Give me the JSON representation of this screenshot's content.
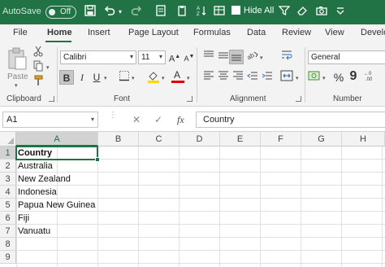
{
  "title_bar": {
    "autosave_label": "AutoSave",
    "autosave_state": "Off",
    "hide_all_label": "Hide All"
  },
  "ribbon_tabs": [
    "File",
    "Home",
    "Insert",
    "Page Layout",
    "Formulas",
    "Data",
    "Review",
    "View",
    "Develo"
  ],
  "active_tab": "Home",
  "clipboard": {
    "paste_label": "Paste",
    "group_label": "Clipboard"
  },
  "font": {
    "name": "Calibri",
    "size": "11",
    "group_label": "Font",
    "bold": "B",
    "italic": "I",
    "underline": "U",
    "color_letter": "A"
  },
  "alignment": {
    "group_label": "Alignment"
  },
  "number": {
    "format": "General",
    "group_label": "Number",
    "percent": "%",
    "comma": "9"
  },
  "formula_bar": {
    "name_box": "A1",
    "cancel_symbol": "✕",
    "enter_symbol": "✓",
    "fx_label": "fx",
    "value": "Country"
  },
  "sheet": {
    "columns": [
      "A",
      "B",
      "C",
      "D",
      "E",
      "F",
      "G",
      "H"
    ],
    "rows": [
      "1",
      "2",
      "3",
      "4",
      "5",
      "6",
      "7",
      "8",
      "9"
    ],
    "selected_cell": "A1",
    "column_a": [
      "Country",
      "Australia",
      "New Zealand",
      "Indonesia",
      "Papua New Guinea",
      "Fiji",
      "Vanuatu"
    ]
  },
  "colors": {
    "accent": "#217346",
    "selected_header": "#d2d2d2"
  }
}
